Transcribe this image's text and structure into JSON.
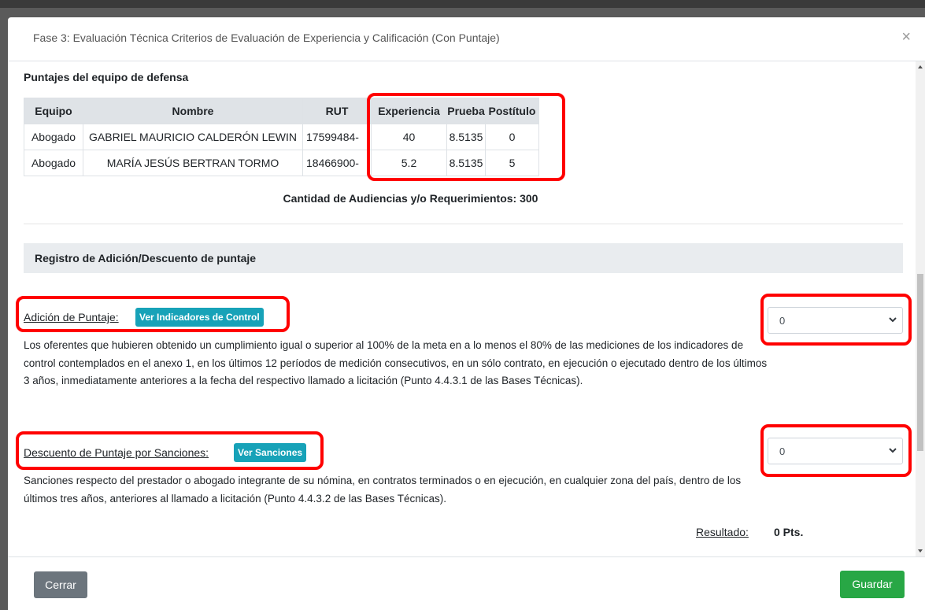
{
  "modal": {
    "title": "Fase 3: Evaluación Técnica Criterios de Evaluación de Experiencia y Calificación (Con Puntaje)",
    "close_glyph": "×"
  },
  "team_section": {
    "title": "Puntajes del equipo de defensa",
    "headers": [
      "Equipo",
      "Nombre",
      "RUT",
      "Experiencia",
      "Prueba",
      "Postítulo"
    ],
    "rows": [
      [
        "Abogado",
        "GABRIEL MAURICIO CALDERÓN LEWIN",
        "17599484-",
        "40",
        "8.5135",
        "0"
      ],
      [
        "Abogado",
        "MARÍA JESÚS BERTRAN TORMO",
        "18466900-",
        "5.2",
        "8.5135",
        "5"
      ]
    ],
    "count_text": "Cantidad de Audiencias y/o Requerimientos: 300"
  },
  "registro": {
    "title": "Registro de Adición/Descuento de puntaje",
    "adicion": {
      "label": "Adición de Puntaje:",
      "button": "Ver Indicadores de Control",
      "select_value": "0",
      "text": "Los oferentes que hubieren obtenido un cumplimiento igual o superior al 100% de la meta en a lo menos el 80% de las mediciones de los indicadores de control contemplados en el anexo 1, en los últimos 12 períodos de medición consecutivos, en un sólo contrato, en ejecución o ejecutado dentro de los últimos 3 años, inmediatamente anteriores a la fecha del respectivo llamado a licitación (Punto 4.4.3.1 de las Bases Técnicas)."
    },
    "descuento": {
      "label": "Descuento de Puntaje por Sanciones:",
      "button": "Ver Sanciones",
      "select_value": "0",
      "text": "Sanciones respecto del prestador o abogado integrante de su nómina, en contratos terminados o en ejecución, en cualquier zona del país, dentro de los últimos tres años, anteriores al llamado a licitación (Punto 4.4.3.2 de las Bases Técnicas)."
    },
    "result_label": "Resultado:",
    "result_value": "0 Pts."
  },
  "footer": {
    "close_label": "Cerrar",
    "save_label": "Guardar"
  },
  "colors": {
    "highlight": "#ff0000",
    "info_button": "#17a2b8",
    "save_button": "#28a745",
    "close_button": "#6c757d"
  }
}
